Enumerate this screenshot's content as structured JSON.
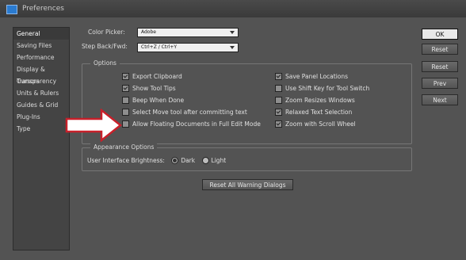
{
  "window": {
    "title": "Preferences"
  },
  "sidebar": {
    "items": [
      {
        "label": "General",
        "selected": true
      },
      {
        "label": "Saving Files",
        "selected": false
      },
      {
        "label": "Performance",
        "selected": false
      },
      {
        "label": "Display & Cursors",
        "selected": false
      },
      {
        "label": "Transparency",
        "selected": false
      },
      {
        "label": "Units & Rulers",
        "selected": false
      },
      {
        "label": "Guides & Grid",
        "selected": false
      },
      {
        "label": "Plug-Ins",
        "selected": false
      },
      {
        "label": "Type",
        "selected": false
      }
    ]
  },
  "general": {
    "color_picker_label": "Color Picker:",
    "color_picker_value": "Adobe",
    "step_label": "Step Back/Fwd:",
    "step_value": "Ctrl+Z / Ctrl+Y"
  },
  "options": {
    "title": "Options",
    "left": [
      {
        "label": "Export Clipboard",
        "checked": true
      },
      {
        "label": "Show Tool Tips",
        "checked": true
      },
      {
        "label": "Beep When Done",
        "checked": false
      },
      {
        "label": "Select Move tool after committing text",
        "checked": false
      },
      {
        "label": "Allow Floating Documents in Full Edit Mode",
        "checked": false
      }
    ],
    "right": [
      {
        "label": "Save Panel Locations",
        "checked": true
      },
      {
        "label": "Use Shift Key for Tool Switch",
        "checked": false
      },
      {
        "label": "Zoom Resizes Windows",
        "checked": false
      },
      {
        "label": "Relaxed Text Selection",
        "checked": true
      },
      {
        "label": "Zoom with Scroll Wheel",
        "checked": true
      }
    ]
  },
  "appearance": {
    "title": "Appearance Options",
    "brightness_label": "User Interface Brightness:",
    "dark_label": "Dark",
    "light_label": "Light",
    "selected": "Dark"
  },
  "reset_warnings_label": "Reset All Warning Dialogs",
  "buttons": {
    "ok": "OK",
    "reset": "Reset",
    "reset2": "Reset",
    "prev": "Prev",
    "next": "Next"
  },
  "colors": {
    "accent_arrow": "#c8202a",
    "dialog_bg": "#535353"
  }
}
